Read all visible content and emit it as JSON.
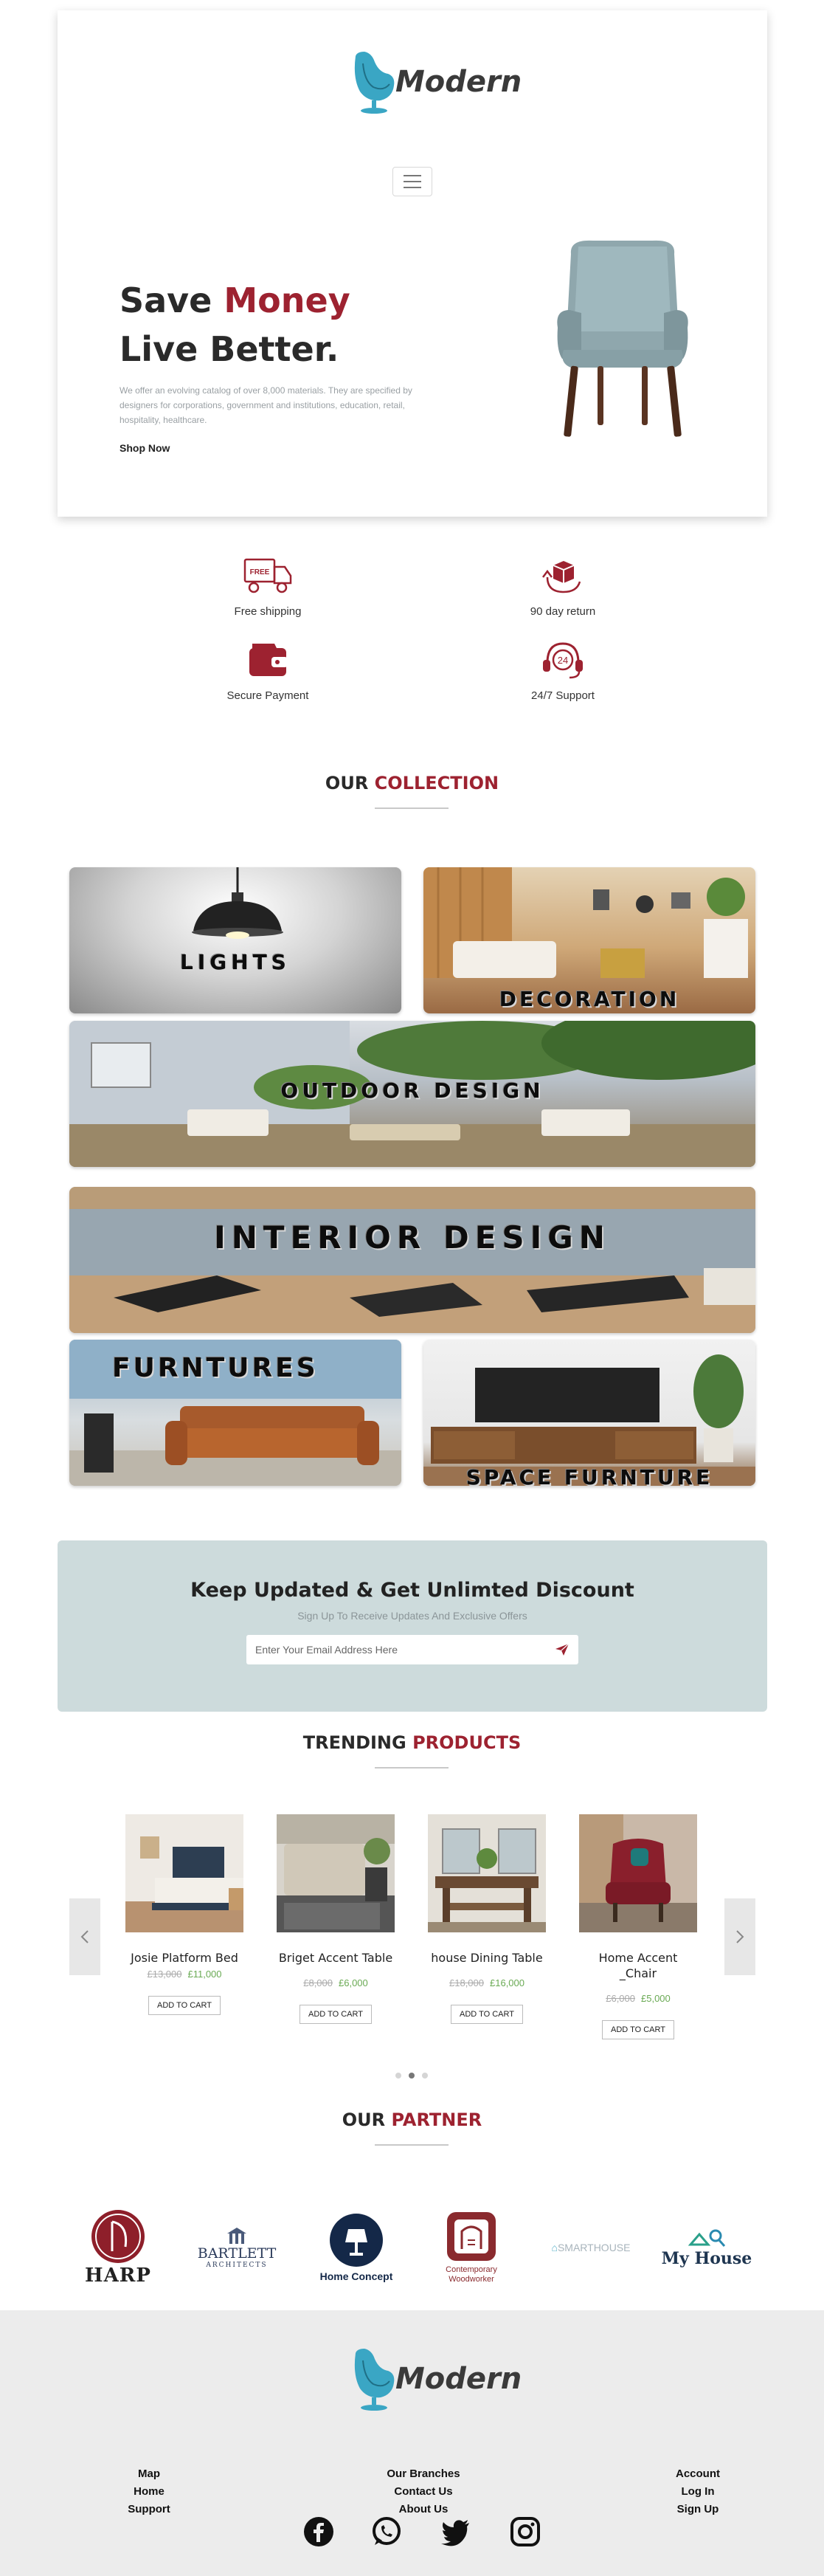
{
  "brand": {
    "name": "Modern"
  },
  "hero": {
    "headline_part1": "Save",
    "headline_accent": "Money",
    "headline_line2": "Live Better.",
    "description": "We offer an evolving catalog of over 8,000 materials. They are specified by designers for corporations, government and institutions, education, retail, hospitality, healthcare.",
    "cta": "Shop Now"
  },
  "features": [
    {
      "label": "Free shipping",
      "icon": "truck-icon",
      "badge": "FREE"
    },
    {
      "label": "90 day return",
      "icon": "return-box-icon"
    },
    {
      "label": "Secure Payment",
      "icon": "wallet-icon"
    },
    {
      "label": "24/7 Support",
      "icon": "support-headset-icon",
      "badge": "24"
    }
  ],
  "collection": {
    "title_plain": "OUR",
    "title_accent": "COLLECTION",
    "tiles": [
      {
        "label": "LIGHTS"
      },
      {
        "label": "DECORATION"
      },
      {
        "label": "OUTDOOR DESIGN"
      },
      {
        "label": "INTERIOR DESIGN"
      },
      {
        "label": "FURNTURES"
      },
      {
        "label": "SPACE FURNTURE"
      }
    ]
  },
  "newsletter": {
    "title": "Keep Updated & Get Unlimted Discount",
    "subtitle": "Sign Up To Receive Updates And Exclusive Offers",
    "placeholder": "Enter Your Email Address Here"
  },
  "trending": {
    "title_plain": "TRENDING",
    "title_accent": "PRODUCTS",
    "products": [
      {
        "name": "Josie Platform Bed",
        "old_price": "£13,000",
        "price": "£11,000",
        "cta": "ADD TO CART"
      },
      {
        "name": "Briget Accent Table",
        "old_price": "£8,000",
        "price": "£6,000",
        "cta": "ADD TO CART"
      },
      {
        "name": "house Dining Table",
        "old_price": "£18,000",
        "price": "£16,000",
        "cta": "ADD TO CART"
      },
      {
        "name": "Home Accent _Chair",
        "old_price": "£6,000",
        "price": "£5,000",
        "cta": "ADD TO CART"
      }
    ],
    "active_slide": 2,
    "slide_count": 3
  },
  "partners": {
    "title_plain": "OUR",
    "title_accent": "PARTNER",
    "logos": [
      {
        "name": "HARP"
      },
      {
        "name": "BARTLETT",
        "sub": "ARCHITECTS"
      },
      {
        "name": "Home Concept"
      },
      {
        "name": "Contemporary Woodworker"
      },
      {
        "name": "SMARTHOUSE"
      },
      {
        "name": "My House"
      }
    ]
  },
  "footer": {
    "col1": [
      "Map",
      "Home",
      "Support"
    ],
    "col2": [
      "Our Branches",
      "Contact Us",
      "About Us"
    ],
    "col3": [
      "Account",
      "Log In",
      "Sign Up"
    ],
    "social": [
      "facebook-icon",
      "whatsapp-icon",
      "twitter-icon",
      "instagram-icon"
    ]
  },
  "colors": {
    "accent": "#9d2230",
    "price_green": "#6aaa54",
    "logo_blue": "#3aa6c4",
    "newsletter_bg": "#cddbdc",
    "footer_bg": "#ececec"
  }
}
